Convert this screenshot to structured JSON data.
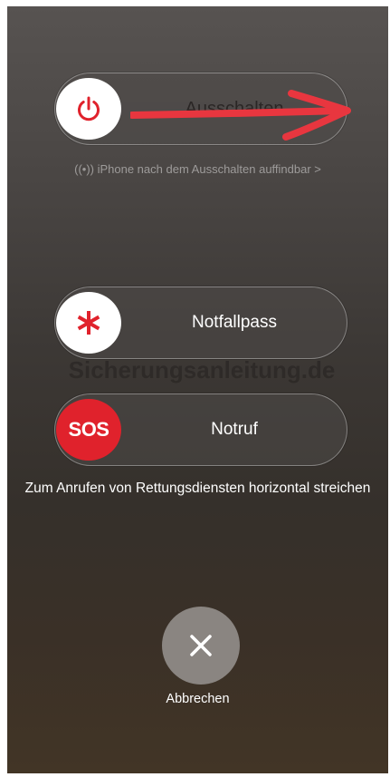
{
  "power_off": {
    "label": "Ausschalten",
    "icon": "power-icon",
    "icon_color": "#e0222c"
  },
  "find_my_note": "((•)) iPhone nach dem Ausschalten auffindbar >",
  "medical_id": {
    "label": "Notfallpass",
    "icon": "asterisk-icon",
    "icon_color": "#e0222c"
  },
  "emergency_sos": {
    "knob_text": "SOS",
    "label": "Notruf",
    "knob_color": "#e0222c"
  },
  "sos_hint": "Zum Anrufen von Rettungsdiensten horizontal streichen",
  "watermark_text": "Sicherungsanleitung.de",
  "cancel": {
    "label": "Abbrechen",
    "icon": "close-icon"
  },
  "annotation_arrow_color": "#e8363f"
}
